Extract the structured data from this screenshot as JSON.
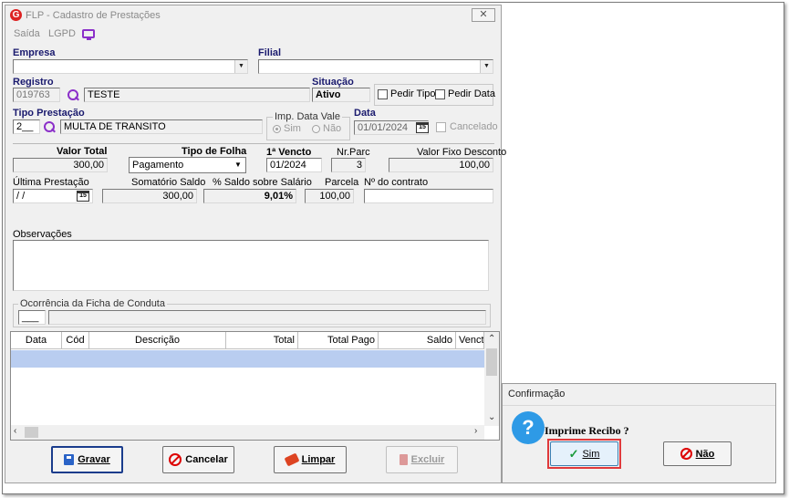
{
  "window": {
    "title": "FLP - Cadastro de Prestações",
    "close_glyph": "✕",
    "logo_letter": "G"
  },
  "menu": {
    "saida": "Saída",
    "lgpd": "LGPD"
  },
  "empresa": {
    "label": "Empresa",
    "value": ""
  },
  "filial": {
    "label": "Filial",
    "value": ""
  },
  "registro": {
    "label": "Registro",
    "code": "019763",
    "name": "TESTE"
  },
  "situacao": {
    "label": "Situação",
    "value": "Ativo"
  },
  "pedir_tipo": {
    "label": "Pedir Tipo",
    "checked": false
  },
  "pedir_data": {
    "label": "Pedir Data",
    "checked": false
  },
  "tipo_prestacao": {
    "label": "Tipo Prestação",
    "code": "2__",
    "name": "MULTA DE TRANSITO"
  },
  "imp_data_vale": {
    "label": "Imp. Data Vale",
    "sim": "Sim",
    "nao": "Não",
    "selected": "Sim"
  },
  "data": {
    "label": "Data",
    "value": "01/01/2024",
    "cal": "15"
  },
  "cancelado": {
    "label": "Cancelado",
    "checked": false
  },
  "valor_total": {
    "label": "Valor Total",
    "value": "300,00"
  },
  "tipo_folha": {
    "label": "Tipo de Folha",
    "value": "Pagamento"
  },
  "primeiro_vencto": {
    "label": "1ª Vencto",
    "value": "01/2024"
  },
  "nr_parc": {
    "label": "Nr.Parc",
    "value": "3"
  },
  "valor_fixo_desconto": {
    "label": "Valor Fixo Desconto",
    "value": "100,00"
  },
  "ultima_prestacao": {
    "label": "Última Prestação",
    "value": " / /",
    "cal": "15"
  },
  "somatorio_saldo": {
    "label": "Somatório Saldo",
    "value": "300,00"
  },
  "pct_saldo_salario": {
    "label": "% Saldo sobre Salário",
    "value": "9,01%"
  },
  "parcela": {
    "label": "Parcela",
    "value": "100,00"
  },
  "nr_contrato": {
    "label": "Nº do contrato",
    "value": ""
  },
  "observacoes": {
    "label": "Observações",
    "value": ""
  },
  "ocorrencia": {
    "label": "Ocorrência da Ficha de Conduta",
    "code": "___",
    "desc": ""
  },
  "grid": {
    "columns": [
      "Data",
      "Cód",
      "Descrição",
      "Total",
      "Total Pago",
      "Saldo",
      "Vencto"
    ],
    "rows": []
  },
  "buttons": {
    "gravar": "Gravar",
    "cancelar": "Cancelar",
    "limpar": "Limpar",
    "excluir": "Excluir"
  },
  "dialog": {
    "title": "Confirmação",
    "message": "Imprime Recibo ?",
    "sim": "Sim",
    "nao": "Não"
  },
  "colors": {
    "accent": "#8b2fc9",
    "highlight": "#b9cdf0",
    "focus_ring": "#e0393b"
  }
}
